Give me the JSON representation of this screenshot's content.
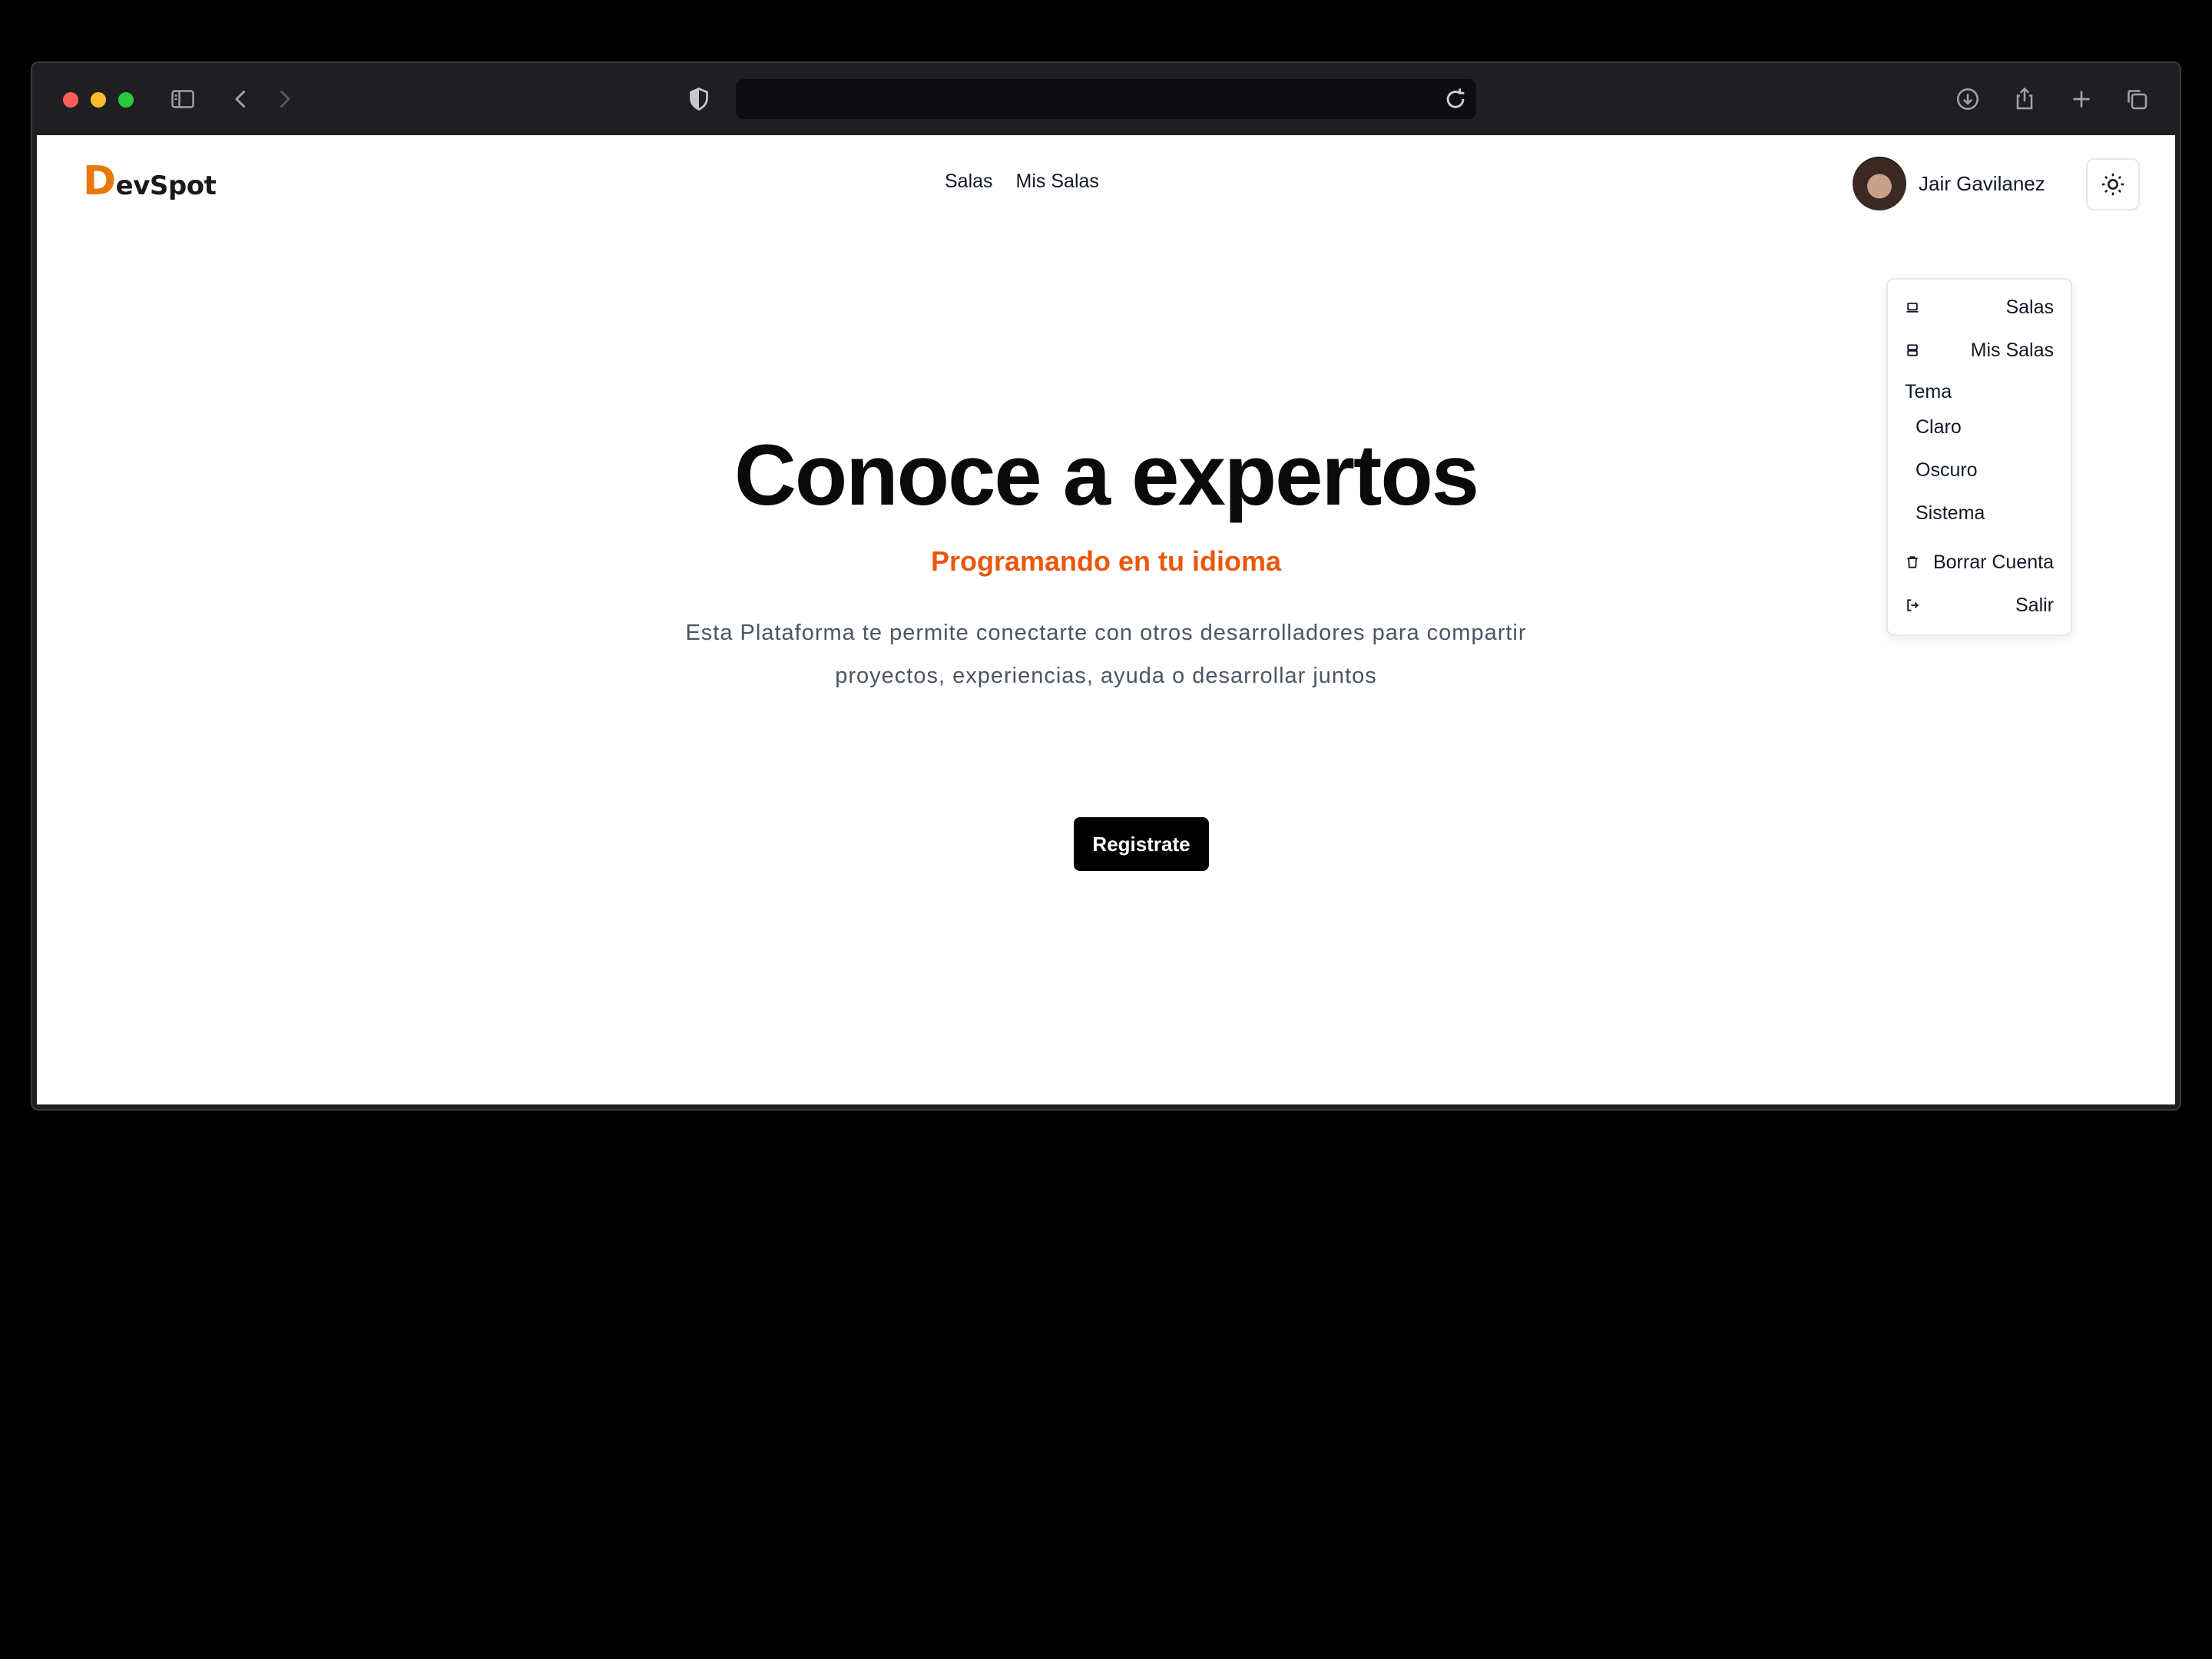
{
  "browser": {
    "url": "",
    "traffic_lights": [
      "#ff5f57",
      "#febc2e",
      "#28c840"
    ]
  },
  "site": {
    "logo_initial": "D",
    "logo_rest": "evSpot",
    "nav": [
      "Salas",
      "Mis Salas"
    ],
    "user_name": "Jair Gavilanez"
  },
  "hero": {
    "title": "Conoce a expertos",
    "subtitle": "Programando en tu idioma",
    "description_line1": "Esta Plataforma te permite conectarte con otros desarrolladores para compartir",
    "description_line2": "proyectos, experiencias, ayuda o desarrollar juntos",
    "cta_label": "Registrate"
  },
  "menu": {
    "salas": "Salas",
    "mis_salas": "Mis Salas",
    "tema_heading": "Tema",
    "claro": "Claro",
    "oscuro": "Oscuro",
    "sistema": "Sistema",
    "borrar": "Borrar Cuenta",
    "salir": "Salir"
  },
  "colors": {
    "accent": "#ea580c",
    "logo_accent": "#e8780c"
  }
}
